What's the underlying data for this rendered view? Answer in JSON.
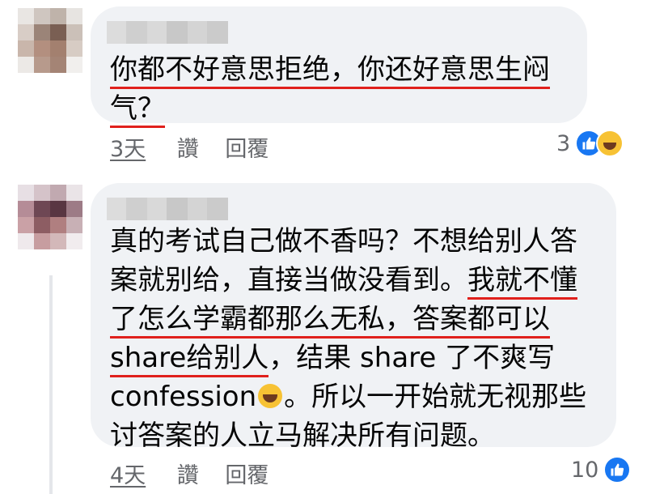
{
  "comments": [
    {
      "lines": [
        [
          {
            "t": "你都不好意思拒绝，你还好意思生闷",
            "hl": true
          }
        ],
        [
          {
            "t": "气？",
            "hl": true
          }
        ]
      ],
      "time": "3天",
      "like_label": "讚",
      "reply_label": "回覆",
      "reaction_count": "3",
      "reactions": [
        "like-icon",
        "haha-icon"
      ]
    },
    {
      "lines": [
        [
          {
            "t": "真的考试自己做不香吗？不想给别人答",
            "hl": false
          }
        ],
        [
          {
            "t": "案就别给，直接当做没看到。",
            "hl": false
          },
          {
            "t": "我就不懂",
            "hl": true
          }
        ],
        [
          {
            "t": "了怎么学霸都那么无私，答案都可以",
            "hl": true
          }
        ],
        [
          {
            "t": "share给别人",
            "hl": true
          },
          {
            "t": "，结果 share 了不爽写",
            "hl": false
          }
        ],
        [
          {
            "t": "confession",
            "hl": false
          },
          {
            "t": "[emoji]",
            "hl": false
          },
          {
            "t": "。所以一开始就无视那些",
            "hl": false
          }
        ],
        [
          {
            "t": "讨答案的人立马解决所有问题。",
            "hl": false
          }
        ]
      ],
      "time": "4天",
      "like_label": "讚",
      "reply_label": "回覆",
      "reaction_count": "10",
      "reactions": [
        "like-icon"
      ]
    }
  ],
  "colors": {
    "bubble": "#f0f2f5",
    "highlight_underline": "#e0201c",
    "meta_text": "#65676b",
    "like_blue": "#1877f2"
  }
}
